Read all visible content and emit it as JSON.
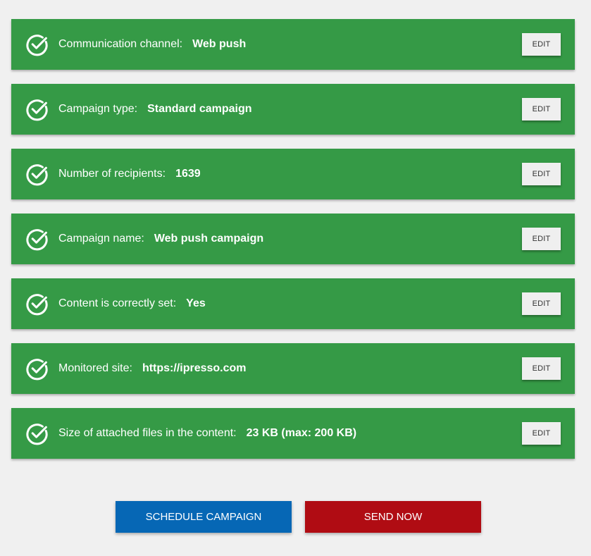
{
  "colors": {
    "row_background": "#359a46",
    "schedule_button": "#0667b5",
    "send_button": "#b00c13",
    "page_background": "#f0f0f0"
  },
  "summary": {
    "rows": [
      {
        "label": "Communication channel:",
        "value": "Web push",
        "edit_label": "EDIT",
        "icon": "check-circle-icon"
      },
      {
        "label": "Campaign type:",
        "value": "Standard campaign",
        "edit_label": "EDIT",
        "icon": "check-circle-icon"
      },
      {
        "label": "Number of recipients:",
        "value": "1639",
        "edit_label": "EDIT",
        "icon": "check-circle-icon"
      },
      {
        "label": "Campaign name:",
        "value": "Web push campaign",
        "edit_label": "EDIT",
        "icon": "check-circle-icon"
      },
      {
        "label": "Content is correctly set:",
        "value": "Yes",
        "edit_label": "EDIT",
        "icon": "check-circle-icon"
      },
      {
        "label": "Monitored site:",
        "value": "https://ipresso.com",
        "edit_label": "EDIT",
        "icon": "check-circle-icon"
      },
      {
        "label": "Size of attached files in the content:",
        "value": "23 KB (max: 200 KB)",
        "edit_label": "EDIT",
        "icon": "check-circle-icon"
      }
    ]
  },
  "actions": {
    "schedule_label": "SCHEDULE CAMPAIGN",
    "send_label": "SEND NOW"
  }
}
